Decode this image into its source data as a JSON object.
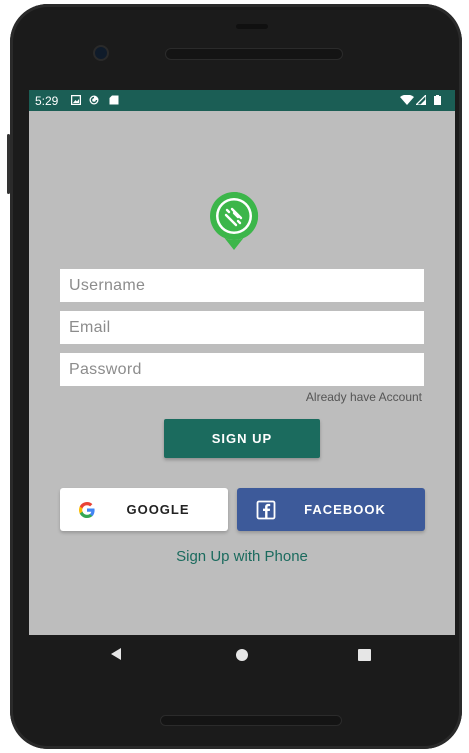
{
  "status_bar": {
    "time": "5:29",
    "icons": [
      "image-notification-icon",
      "sync-notification-icon",
      "sd-card-icon",
      "wifi-icon",
      "signal-icon",
      "battery-icon"
    ],
    "color": "#1b5e55"
  },
  "app": {
    "logo": "chat-bubble-logo-icon",
    "username_placeholder": "Username",
    "email_placeholder": "Email",
    "password_placeholder": "Password",
    "already_account": "Already have Account",
    "signup_label": "SIGN UP",
    "google_label": "GOOGLE",
    "facebook_label": "FACEBOOK",
    "phone_signup": "Sign Up with Phone",
    "colors": {
      "background": "#bdbdbd",
      "primary": "#1b6b5e",
      "facebook": "#3d5a9a",
      "logo_green": "#3cb64a"
    }
  },
  "nav_bar": {
    "buttons": [
      "back-icon",
      "home-icon",
      "recents-icon"
    ]
  }
}
